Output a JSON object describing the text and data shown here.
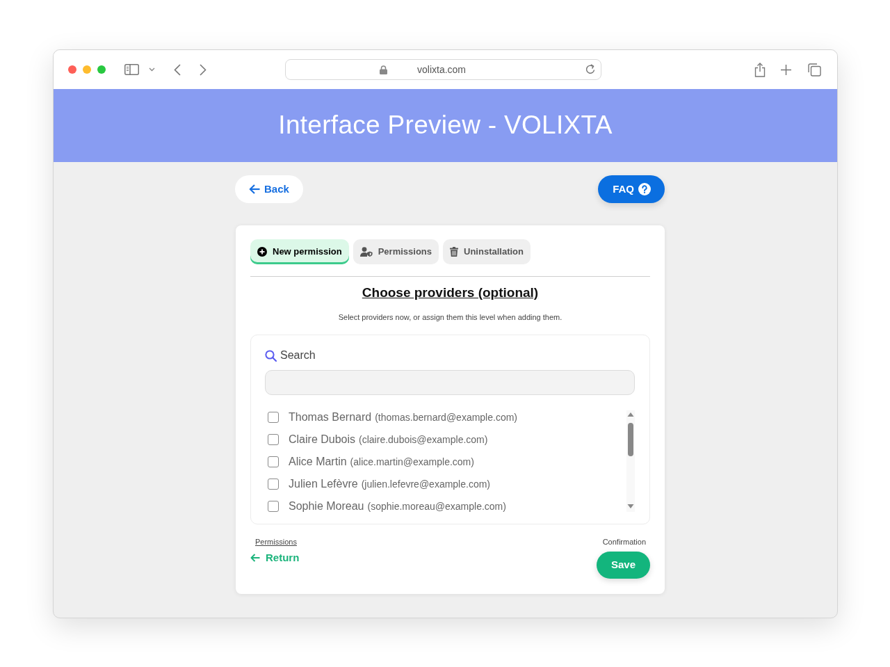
{
  "browser": {
    "url": "volixta.com"
  },
  "header": {
    "title": "Interface Preview - VOLIXTA"
  },
  "top_actions": {
    "back": "Back",
    "faq": "FAQ"
  },
  "tabs": [
    {
      "label": "New permission",
      "selected": true
    },
    {
      "label": "Permissions",
      "selected": false
    },
    {
      "label": "Uninstallation",
      "selected": false
    }
  ],
  "section": {
    "title": "Choose providers (optional)",
    "subtitle": "Select providers now, or assign them this level when adding them."
  },
  "search": {
    "label": "Search"
  },
  "providers": [
    {
      "name": "Thomas Bernard",
      "email": "(thomas.bernard@example.com)",
      "checked": false
    },
    {
      "name": "Claire Dubois",
      "email": "(claire.dubois@example.com)",
      "checked": false
    },
    {
      "name": "Alice Martin",
      "email": "(alice.martin@example.com)",
      "checked": false
    },
    {
      "name": "Julien Lefèvre",
      "email": "(julien.lefevre@example.com)",
      "checked": false
    },
    {
      "name": "Sophie Moreau",
      "email": "(sophie.moreau@example.com)",
      "checked": false
    }
  ],
  "footer": {
    "previous_step": "Permissions",
    "return": "Return",
    "next_step": "Confirmation",
    "save": "Save"
  }
}
